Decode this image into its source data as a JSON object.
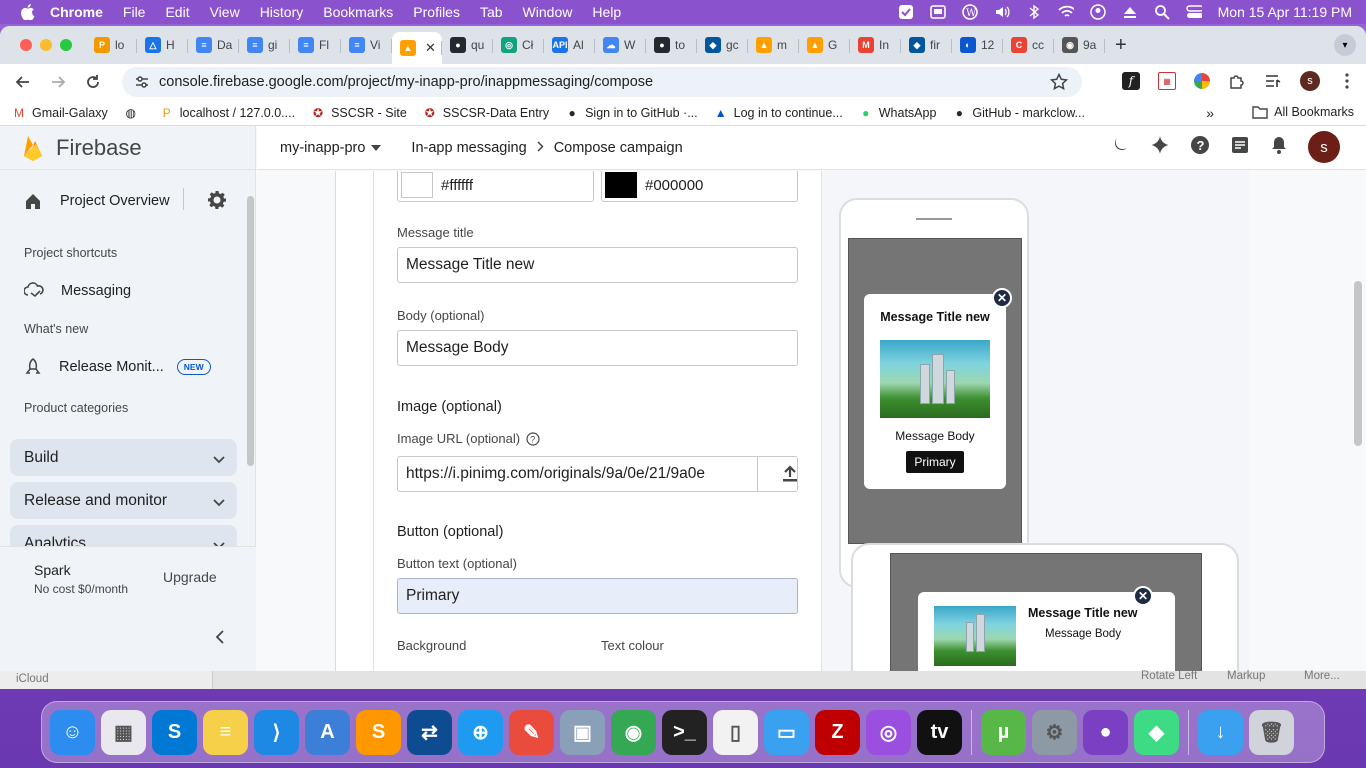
{
  "menubar": {
    "app": "Chrome",
    "items": [
      "File",
      "Edit",
      "View",
      "History",
      "Bookmarks",
      "Profiles",
      "Tab",
      "Window",
      "Help"
    ],
    "clock": "Mon 15 Apr  11:19 PM"
  },
  "browser": {
    "tabs": [
      {
        "label": "lo",
        "color": "#f29900",
        "glyph": "P"
      },
      {
        "label": "H",
        "color": "#1a73e8",
        "glyph": "△"
      },
      {
        "label": "Da",
        "color": "#4285f4",
        "glyph": "≡"
      },
      {
        "label": "gi",
        "color": "#4285f4",
        "glyph": "≡"
      },
      {
        "label": "Fl",
        "color": "#4285f4",
        "glyph": "≡"
      },
      {
        "label": "Vi",
        "color": "#4285f4",
        "glyph": "≡"
      },
      {
        "label": "",
        "color": "#ffa000",
        "glyph": "▲",
        "active": true
      },
      {
        "label": "qu",
        "color": "#24292f",
        "glyph": "●"
      },
      {
        "label": "Cł",
        "color": "#10a37f",
        "glyph": "◎"
      },
      {
        "label": "Al",
        "color": "#1a73e8",
        "glyph": "API"
      },
      {
        "label": "W",
        "color": "#4285f4",
        "glyph": "☁"
      },
      {
        "label": "to",
        "color": "#24292f",
        "glyph": "●"
      },
      {
        "label": "gc",
        "color": "#02569b",
        "glyph": "◆"
      },
      {
        "label": "m",
        "color": "#ffa000",
        "glyph": "▲"
      },
      {
        "label": "G",
        "color": "#ffa000",
        "glyph": "▲"
      },
      {
        "label": "In",
        "color": "#ea4335",
        "glyph": "M"
      },
      {
        "label": "fir",
        "color": "#02569b",
        "glyph": "◆"
      },
      {
        "label": "12",
        "color": "#0b57d0",
        "glyph": "◐"
      },
      {
        "label": "cc",
        "color": "#ea4335",
        "glyph": "C"
      },
      {
        "label": "9a",
        "color": "#555555",
        "glyph": "◉"
      }
    ],
    "url": "console.firebase.google.com/project/my-inapp-pro/inappmessaging/compose",
    "profile_initial": "s",
    "bookmarks": [
      {
        "label": "Gmail-Galaxy",
        "icon_color": "#ea4335",
        "glyph": "M"
      },
      {
        "label": "",
        "icon_color": "#222222",
        "glyph": "◍"
      },
      {
        "label": "localhost / 127.0.0....",
        "icon_color": "#f29900",
        "glyph": "P"
      },
      {
        "label": "SSCSR - Site",
        "icon_color": "#b3261e",
        "glyph": "✪"
      },
      {
        "label": "SSCSR-Data Entry",
        "icon_color": "#b3261e",
        "glyph": "✪"
      },
      {
        "label": "Sign in to GitHub ·...",
        "icon_color": "#24292f",
        "glyph": "●"
      },
      {
        "label": "Log in to continue...",
        "icon_color": "#0052cc",
        "glyph": "▲"
      },
      {
        "label": "WhatsApp",
        "icon_color": "#25d366",
        "glyph": "●"
      },
      {
        "label": "GitHub - markclow...",
        "icon_color": "#24292f",
        "glyph": "●"
      }
    ],
    "bookmarks_more": "»",
    "all_bookmarks": "All Bookmarks"
  },
  "firebase": {
    "brand": "Firebase",
    "project_overview": "Project Overview",
    "shortcuts_label": "Project shortcuts",
    "messaging": "Messaging",
    "whats_new": "What's new",
    "release_monitor": "Release Monit...",
    "new_badge": "NEW",
    "product_categories": "Product categories",
    "categories": [
      "Build",
      "Release and monitor",
      "Analytics"
    ],
    "plan": "Spark",
    "plan_desc": "No cost $0/month",
    "upgrade": "Upgrade",
    "project": "my-inapp-pro",
    "breadcrumb1": "In-app messaging",
    "breadcrumb2": "Compose campaign"
  },
  "form": {
    "bg_color": "#ffffff",
    "text_color": "#000000",
    "title_label": "Message title",
    "title_value": "Message Title new",
    "body_label": "Body (optional)",
    "body_value": "Message Body",
    "image_section": "Image (optional)",
    "image_url_label": "Image URL (optional)",
    "image_url_value": "https://i.pinimg.com/originals/9a/0e/21/9a0e",
    "button_section": "Button (optional)",
    "button_text_label": "Button text (optional)",
    "button_text_value": "Primary",
    "background_label": "Background",
    "text_colour_label": "Text colour"
  },
  "preview": {
    "title": "Message Title new",
    "body": "Message Body",
    "button": "Primary"
  },
  "under_window": {
    "icloud": "iCloud",
    "rotate_left": "Rotate Left",
    "markup": "Markup",
    "more": "More..."
  },
  "dock": [
    {
      "name": "finder",
      "color": "#2d8cf0",
      "glyph": "☺"
    },
    {
      "name": "launchpad",
      "color": "#e8e8ee",
      "glyph": "▦"
    },
    {
      "name": "skype",
      "color": "#0078d4",
      "glyph": "S"
    },
    {
      "name": "notes",
      "color": "#f7d04a",
      "glyph": "≡"
    },
    {
      "name": "vscode",
      "color": "#1e88e5",
      "glyph": "⟩"
    },
    {
      "name": "xcode-tools",
      "color": "#3b7fd8",
      "glyph": "A"
    },
    {
      "name": "sublime",
      "color": "#ff9800",
      "glyph": "S"
    },
    {
      "name": "teamviewer",
      "color": "#0e4c92",
      "glyph": "⇄"
    },
    {
      "name": "safari",
      "color": "#1e9bf0",
      "glyph": "⊕"
    },
    {
      "name": "preview-app",
      "color": "#e94b3c",
      "glyph": "✎"
    },
    {
      "name": "image-capture",
      "color": "#8aa0b8",
      "glyph": "▣"
    },
    {
      "name": "chrome",
      "color": "#34a853",
      "glyph": "◉"
    },
    {
      "name": "terminal",
      "color": "#222222",
      "glyph": ">_"
    },
    {
      "name": "textedit",
      "color": "#f2f2f2",
      "glyph": "▯"
    },
    {
      "name": "files",
      "color": "#3aa0f0",
      "glyph": "▭"
    },
    {
      "name": "filezilla",
      "color": "#bf0000",
      "glyph": "Z"
    },
    {
      "name": "podcasts",
      "color": "#9b4fe0",
      "glyph": "◎"
    },
    {
      "name": "apple-tv",
      "color": "#111111",
      "glyph": "tv"
    },
    {
      "name": "utorrent",
      "color": "#58b847",
      "glyph": "µ"
    },
    {
      "name": "system-settings",
      "color": "#8d9aa6",
      "glyph": "⚙"
    },
    {
      "name": "github-desktop",
      "color": "#7b3fc4",
      "glyph": "●"
    },
    {
      "name": "android-studio",
      "color": "#3ddc84",
      "glyph": "◆"
    },
    {
      "name": "downloads",
      "color": "#3aa0f0",
      "glyph": "↓"
    },
    {
      "name": "trash",
      "color": "#d0d4da",
      "glyph": "🗑"
    }
  ]
}
